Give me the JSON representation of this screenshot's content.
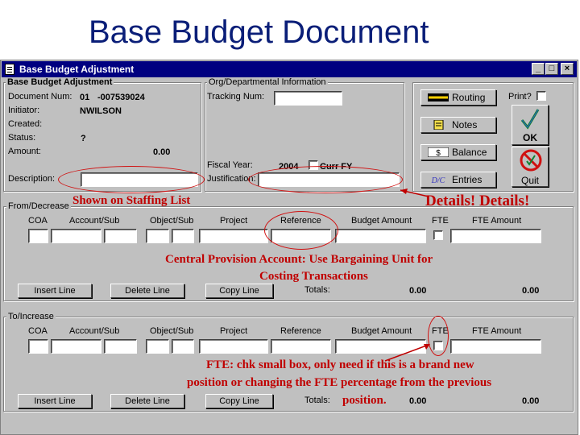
{
  "slide": {
    "title": "Base Budget Document"
  },
  "window": {
    "title": "Base Budget Adjustment",
    "min": "_",
    "max": "□",
    "close": "×"
  },
  "header": {
    "group_title": "Base Budget Adjustment",
    "doc_num_label": "Document Num:",
    "doc_num_prefix": "01",
    "doc_num": "-007539024",
    "initiator_label": "Initiator:",
    "initiator": "NWILSON",
    "created_label": "Created:",
    "status_label": "Status:",
    "status": "?",
    "amount_label": "Amount:",
    "amount": "0.00",
    "description_label": "Description:"
  },
  "org": {
    "group_title": "Org/Departmental Information",
    "tracking_label": "Tracking Num:",
    "fiscal_year_label": "Fiscal Year:",
    "fiscal_year": "2004",
    "curr_fy_label": "Curr FY",
    "justification_label": "Justification:"
  },
  "side_buttons": {
    "routing": "Routing",
    "notes": "Notes",
    "balance": "Balance",
    "entries": "Entries",
    "print_label": "Print?",
    "ok": "OK",
    "quit": "Quit",
    "balance_icon_text": "$",
    "entries_icon_text": "D/C"
  },
  "columns": [
    "COA",
    "Account/Sub",
    "Object/Sub",
    "Project",
    "Reference",
    "Budget Amount",
    "FTE",
    "FTE Amount"
  ],
  "from_section": {
    "title": "From/Decrease",
    "insert": "Insert Line",
    "delete": "Delete Line",
    "copy": "Copy Line",
    "totals_label": "Totals:",
    "total_amount": "0.00",
    "total_fte": "0.00"
  },
  "to_section": {
    "title": "To/Increase",
    "insert": "Insert Line",
    "delete": "Delete Line",
    "copy": "Copy Line",
    "totals_label": "Totals:",
    "total_amount": "0.00",
    "total_fte": "0.00"
  },
  "annotations": {
    "staffing": "Shown on Staffing List",
    "details": "Details! Details!",
    "central_1": "Central Provision Account: Use Bargaining Unit for",
    "central_2": "Costing Transactions",
    "fte_1": "FTE:  chk small box, only need if this is a brand new",
    "fte_2": "position or changing the FTE percentage from the previous",
    "fte_3": "position."
  },
  "colors": {
    "window_bg": "#c0c0c0",
    "titlebar": "#000080",
    "annotation": "#c00000",
    "slide_title": "#0a1e78"
  }
}
